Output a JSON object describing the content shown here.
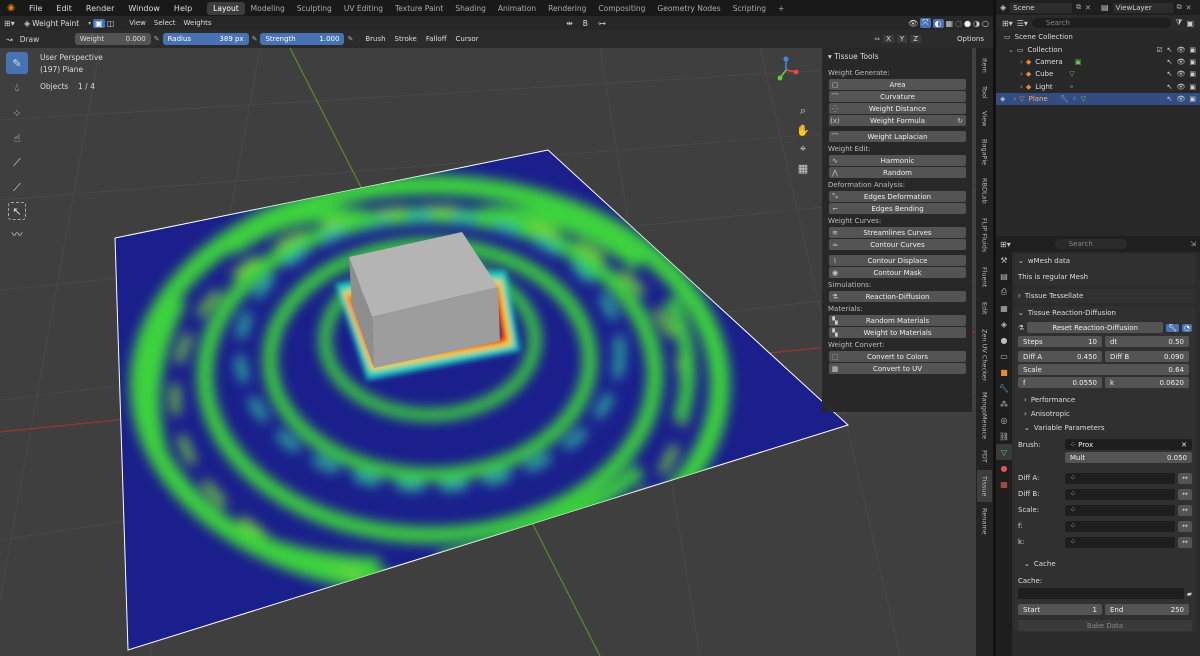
{
  "menu": {
    "logo_icon": "blender-icon",
    "items": [
      "File",
      "Edit",
      "Render",
      "Window",
      "Help"
    ]
  },
  "workspaces": [
    "Layout",
    "Modeling",
    "Sculpting",
    "UV Editing",
    "Texture Paint",
    "Shading",
    "Animation",
    "Rendering",
    "Compositing",
    "Geometry Nodes",
    "Scripting",
    "+"
  ],
  "header": {
    "mode": "Weight Paint",
    "menus": [
      "View",
      "Select",
      "Weights"
    ],
    "pivot_label": "B"
  },
  "tool_settings": {
    "tool": "Draw",
    "weight_label": "Weight",
    "weight_value": "0.000",
    "radius_label": "Radius",
    "radius_value": "389 px",
    "strength_label": "Strength",
    "strength_value": "1.000",
    "dropdowns": [
      "Brush",
      "Stroke",
      "Falloff",
      "Cursor"
    ],
    "axes": [
      "X",
      "Y",
      "Z"
    ],
    "options_label": "Options"
  },
  "viewport": {
    "perspective": "User Perspective",
    "object": "(197) Plane",
    "objects_label": "Objects",
    "objects_count": "1 / 4",
    "tools": [
      "brush-icon",
      "blur-icon",
      "average-icon",
      "smear-icon",
      "sample-icon",
      "gradient-icon",
      "select-box-icon",
      "annotate-icon"
    ]
  },
  "tissue_panel": {
    "title": "Tissue Tools",
    "sections": [
      {
        "label": "Weight Generate:",
        "buttons": [
          "Area",
          "Curvature",
          "Weight Distance",
          "Weight Formula",
          "",
          "Weight Laplacian"
        ]
      },
      {
        "label": "Weight Edit:",
        "buttons": [
          "Harmonic",
          "Random"
        ]
      },
      {
        "label": "Deformation Analysis:",
        "buttons": [
          "Edges Deformation",
          "Edges Bending"
        ]
      },
      {
        "label": "Weight Curves:",
        "buttons": [
          "Streamlines Curves",
          "Contour Curves",
          "",
          "Contour Displace",
          "Contour Mask"
        ]
      },
      {
        "label": "Simulations:",
        "buttons": [
          "Reaction-Diffusion"
        ]
      },
      {
        "label": "Materials:",
        "buttons": [
          "Random Materials",
          "Weight to Materials"
        ]
      },
      {
        "label": "Weight Convert:",
        "buttons": [
          "Convert to Colors",
          "Convert to UV"
        ]
      }
    ]
  },
  "n_tabs": [
    "Item",
    "Tool",
    "View",
    "BagaPie",
    "RBDLab",
    "FLIP Fluids",
    "Fluent",
    "Edit",
    "Zen UV Checker",
    "MangoMenace",
    "PDT",
    "Tissue",
    "Rename"
  ],
  "outliner": {
    "scene": "Scene",
    "view_layer": "ViewLayer",
    "search_placeholder": "Search",
    "rows": [
      {
        "label": "Scene Collection"
      },
      {
        "label": "Collection"
      },
      {
        "label": "Camera"
      },
      {
        "label": "Cube"
      },
      {
        "label": "Light"
      },
      {
        "label": "Plane"
      }
    ]
  },
  "properties": {
    "search_placeholder": "Search",
    "wmesh_title": "wMesh data",
    "wmesh_info": "This is regular Mesh",
    "tessellate_title": "Tissue Tessellate",
    "rd_title": "Tissue Reaction-Diffusion",
    "reset_label": "Reset Reaction-Diffusion",
    "steps_label": "Steps",
    "steps_value": "10",
    "dt_label": "dt",
    "dt_value": "0.50",
    "diffa_label": "Diff A",
    "diffa_value": "0.450",
    "diffb_label": "Diff B",
    "diffb_value": "0.090",
    "scale_label": "Scale",
    "scale_value": "0.64",
    "f_label": "f",
    "f_value": "0.0550",
    "k_label": "k",
    "k_value": "0.0620",
    "performance_label": "Performance",
    "anisotropic_label": "Anisotropic",
    "variable_label": "Variable Parameters",
    "brush_label": "Brush:",
    "brush_value": "Prox",
    "mult_label": "Mult",
    "mult_value": "0.050",
    "var_labels": [
      "Diff A:",
      "Diff B:",
      "Scale:",
      "f:",
      "k:"
    ],
    "cache_title": "Cache",
    "cache_label": "Cache:",
    "start_label": "Start",
    "start_value": "1",
    "end_label": "End",
    "end_value": "250",
    "bake_label": "Bake Data"
  },
  "colors": {
    "accent": "#4772b3",
    "plane_blue": "#1a1f8c",
    "pattern_green": "#3cd23c",
    "selected_row": "#334d80"
  }
}
